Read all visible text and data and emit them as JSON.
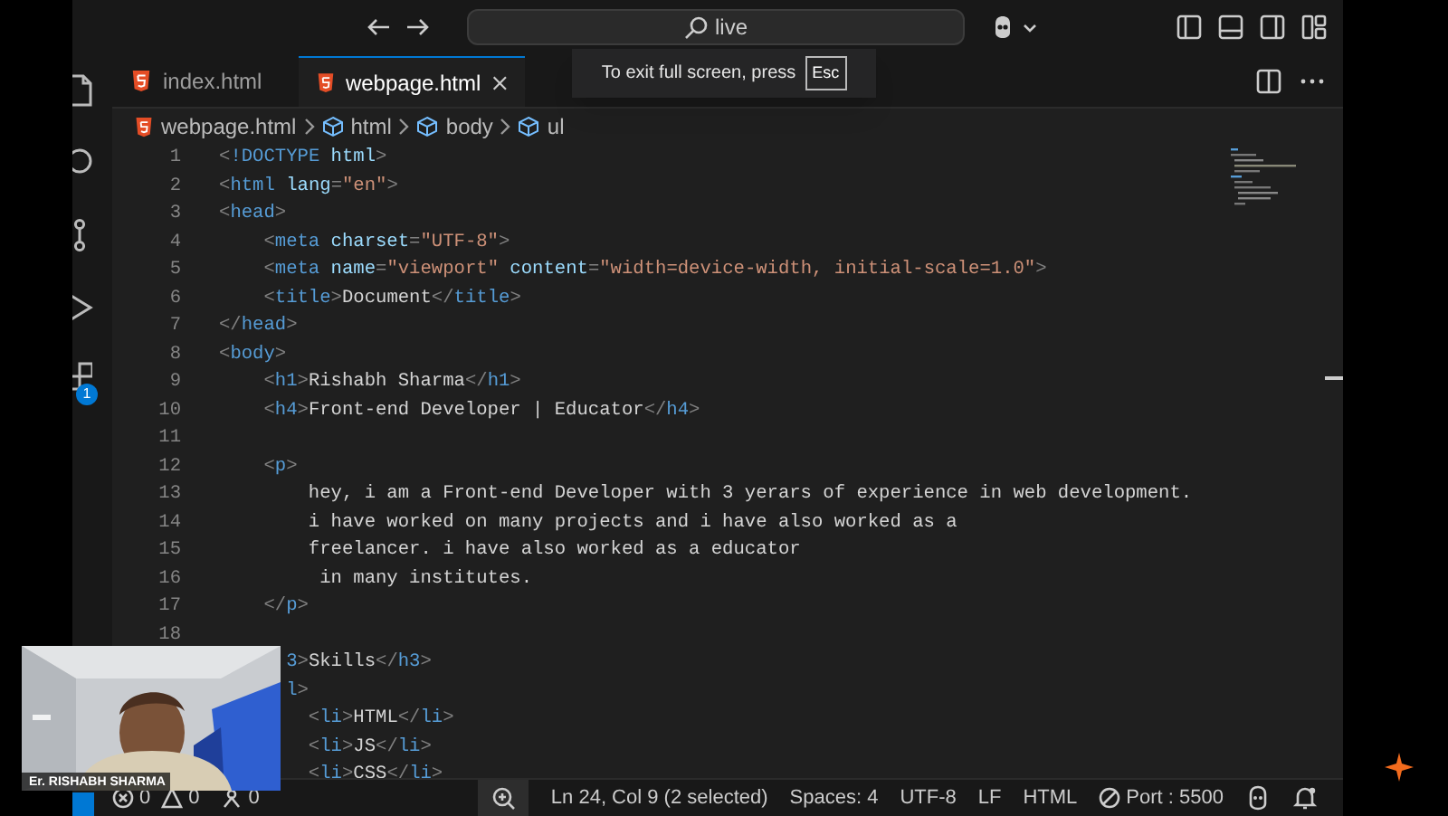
{
  "title_bar": {
    "search": "live"
  },
  "tabs": [
    {
      "label": "index.html",
      "selected": false
    },
    {
      "label": "webpage.html",
      "selected": true
    }
  ],
  "toast": {
    "text": "To exit full screen, press",
    "key": "Esc"
  },
  "breadcrumb": [
    "webpage.html",
    "html",
    "body",
    "ul"
  ],
  "activity_bar": {
    "badge": "1"
  },
  "code_lines": [
    {
      "number": "1",
      "kind": "top",
      "tokens": [
        {
          "kind": "punct",
          "text": "<"
        },
        {
          "kind": "tag",
          "text": "!DOCTYPE"
        },
        {
          "kind": "attr",
          "text": " html"
        },
        {
          "kind": "punct",
          "text": ">"
        }
      ]
    },
    {
      "number": "2",
      "kind": "top",
      "tokens": [
        {
          "kind": "punct",
          "text": "<"
        },
        {
          "kind": "tag",
          "text": "html"
        },
        {
          "kind": "attr",
          "text": " lang"
        },
        {
          "kind": "punct",
          "text": "="
        },
        {
          "kind": "string",
          "text": "\"en\""
        },
        {
          "kind": "punct",
          "text": ">"
        }
      ]
    },
    {
      "number": "3",
      "kind": "top",
      "tokens": [
        {
          "kind": "punct",
          "text": "<"
        },
        {
          "kind": "tag",
          "text": "head"
        },
        {
          "kind": "punct",
          "text": ">"
        }
      ]
    },
    {
      "number": "4",
      "kind": "nested",
      "tokens": [
        {
          "kind": "punct",
          "text": "<"
        },
        {
          "kind": "tag",
          "text": "meta"
        },
        {
          "kind": "attr",
          "text": " charset"
        },
        {
          "kind": "punct",
          "text": "="
        },
        {
          "kind": "string",
          "text": "\"UTF-8\""
        },
        {
          "kind": "punct",
          "text": ">"
        }
      ]
    },
    {
      "number": "5",
      "kind": "nested",
      "tokens": [
        {
          "kind": "punct",
          "text": "<"
        },
        {
          "kind": "tag",
          "text": "meta"
        },
        {
          "kind": "attr",
          "text": " name"
        },
        {
          "kind": "punct",
          "text": "="
        },
        {
          "kind": "string",
          "text": "\"viewport\""
        },
        {
          "kind": "attr",
          "text": " content"
        },
        {
          "kind": "punct",
          "text": "="
        },
        {
          "kind": "string",
          "text": "\"width=device-width, initial-scale=1.0\""
        },
        {
          "kind": "punct",
          "text": ">"
        }
      ]
    },
    {
      "number": "6",
      "kind": "nested",
      "tokens": [
        {
          "kind": "punct",
          "text": "<"
        },
        {
          "kind": "tag",
          "text": "title"
        },
        {
          "kind": "punct",
          "text": ">"
        },
        {
          "kind": "text",
          "text": "Document"
        },
        {
          "kind": "punct",
          "text": "</"
        },
        {
          "kind": "tag",
          "text": "title"
        },
        {
          "kind": "punct",
          "text": ">"
        }
      ]
    },
    {
      "number": "7",
      "kind": "top",
      "tokens": [
        {
          "kind": "punct",
          "text": "</"
        },
        {
          "kind": "tag",
          "text": "head"
        },
        {
          "kind": "punct",
          "text": ">"
        }
      ]
    },
    {
      "number": "8",
      "kind": "top",
      "tokens": [
        {
          "kind": "punct",
          "text": "<"
        },
        {
          "kind": "tag",
          "text": "body"
        },
        {
          "kind": "punct",
          "text": ">"
        }
      ]
    },
    {
      "number": "9",
      "kind": "nested",
      "tokens": [
        {
          "kind": "punct",
          "text": "<"
        },
        {
          "kind": "tag",
          "text": "h1"
        },
        {
          "kind": "punct",
          "text": ">"
        },
        {
          "kind": "text",
          "text": "Rishabh Sharma"
        },
        {
          "kind": "punct",
          "text": "</"
        },
        {
          "kind": "tag",
          "text": "h1"
        },
        {
          "kind": "punct",
          "text": ">"
        }
      ]
    },
    {
      "number": "10",
      "kind": "nested",
      "tokens": [
        {
          "kind": "punct",
          "text": "<"
        },
        {
          "kind": "tag",
          "text": "h4"
        },
        {
          "kind": "punct",
          "text": ">"
        },
        {
          "kind": "text",
          "text": "Front-end Developer | Educator"
        },
        {
          "kind": "punct",
          "text": "</"
        },
        {
          "kind": "tag",
          "text": "h4"
        },
        {
          "kind": "punct",
          "text": ">"
        }
      ]
    },
    {
      "number": "11",
      "kind": "top"
    },
    {
      "number": "12",
      "kind": "nested",
      "tokens": [
        {
          "kind": "punct",
          "text": "<"
        },
        {
          "kind": "tag",
          "text": "p"
        },
        {
          "kind": "punct",
          "text": ">"
        }
      ]
    },
    {
      "number": "13",
      "kind": "inner",
      "tokens": [
        {
          "kind": "text",
          "text": "hey, i am a Front-end Developer with 3 yerars of experience in web development."
        }
      ]
    },
    {
      "number": "14",
      "kind": "inner",
      "tokens": [
        {
          "kind": "text",
          "text": "i have worked on many projects and i have also worked as a"
        }
      ]
    },
    {
      "number": "15",
      "kind": "inner",
      "tokens": [
        {
          "kind": "text",
          "text": "freelancer. i have also worked as a educator"
        }
      ]
    },
    {
      "number": "16",
      "kind": "inner",
      "tokens": [
        {
          "kind": "text",
          "text": " in many institutes."
        }
      ]
    },
    {
      "number": "17",
      "kind": "nested",
      "tokens": [
        {
          "kind": "punct",
          "text": "</"
        },
        {
          "kind": "tag",
          "text": "p"
        },
        {
          "kind": "punct",
          "text": ">"
        }
      ]
    },
    {
      "number": "18",
      "kind": "top"
    },
    {
      "kind": "covered",
      "tokens": [
        {
          "kind": "tag",
          "text": "3"
        },
        {
          "kind": "punct",
          "text": ">"
        },
        {
          "kind": "text",
          "text": "Skills"
        },
        {
          "kind": "punct",
          "text": "</"
        },
        {
          "kind": "tag",
          "text": "h3"
        },
        {
          "kind": "punct",
          "text": ">"
        }
      ]
    },
    {
      "kind": "covered",
      "tokens": [
        {
          "kind": "tag",
          "text": "l"
        },
        {
          "kind": "punct",
          "text": ">"
        }
      ]
    },
    {
      "kind": "inner",
      "tokens": [
        {
          "kind": "punct",
          "text": "<"
        },
        {
          "kind": "tag",
          "text": "li"
        },
        {
          "kind": "punct",
          "text": ">"
        },
        {
          "kind": "text",
          "text": "HTML"
        },
        {
          "kind": "punct",
          "text": "</"
        },
        {
          "kind": "tag",
          "text": "li"
        },
        {
          "kind": "punct",
          "text": ">"
        }
      ]
    },
    {
      "kind": "inner",
      "tokens": [
        {
          "kind": "punct",
          "text": "<"
        },
        {
          "kind": "tag",
          "text": "li"
        },
        {
          "kind": "punct",
          "text": ">"
        },
        {
          "kind": "text",
          "text": "JS"
        },
        {
          "kind": "punct",
          "text": "</"
        },
        {
          "kind": "tag",
          "text": "li"
        },
        {
          "kind": "punct",
          "text": ">"
        }
      ]
    },
    {
      "kind": "inner",
      "tokens": [
        {
          "kind": "punct",
          "text": "<"
        },
        {
          "kind": "tag",
          "text": "li"
        },
        {
          "kind": "punct",
          "text": ">"
        },
        {
          "kind": "text",
          "text": "CSS"
        },
        {
          "kind": "punct",
          "text": "</"
        },
        {
          "kind": "tag",
          "text": "li"
        },
        {
          "kind": "punct",
          "text": ">"
        }
      ]
    }
  ],
  "webcam": {
    "kind": "picture",
    "caption": "Er. RISHABH SHARMA"
  },
  "status_bar": {
    "errors": "0",
    "warnings": "0",
    "ports": "0",
    "position": "Ln 24, Col 9 (2 selected)",
    "spaces": "Spaces: 4",
    "encoding": "UTF-8",
    "eol": "LF",
    "language": "HTML",
    "port": "Port : 5500"
  }
}
